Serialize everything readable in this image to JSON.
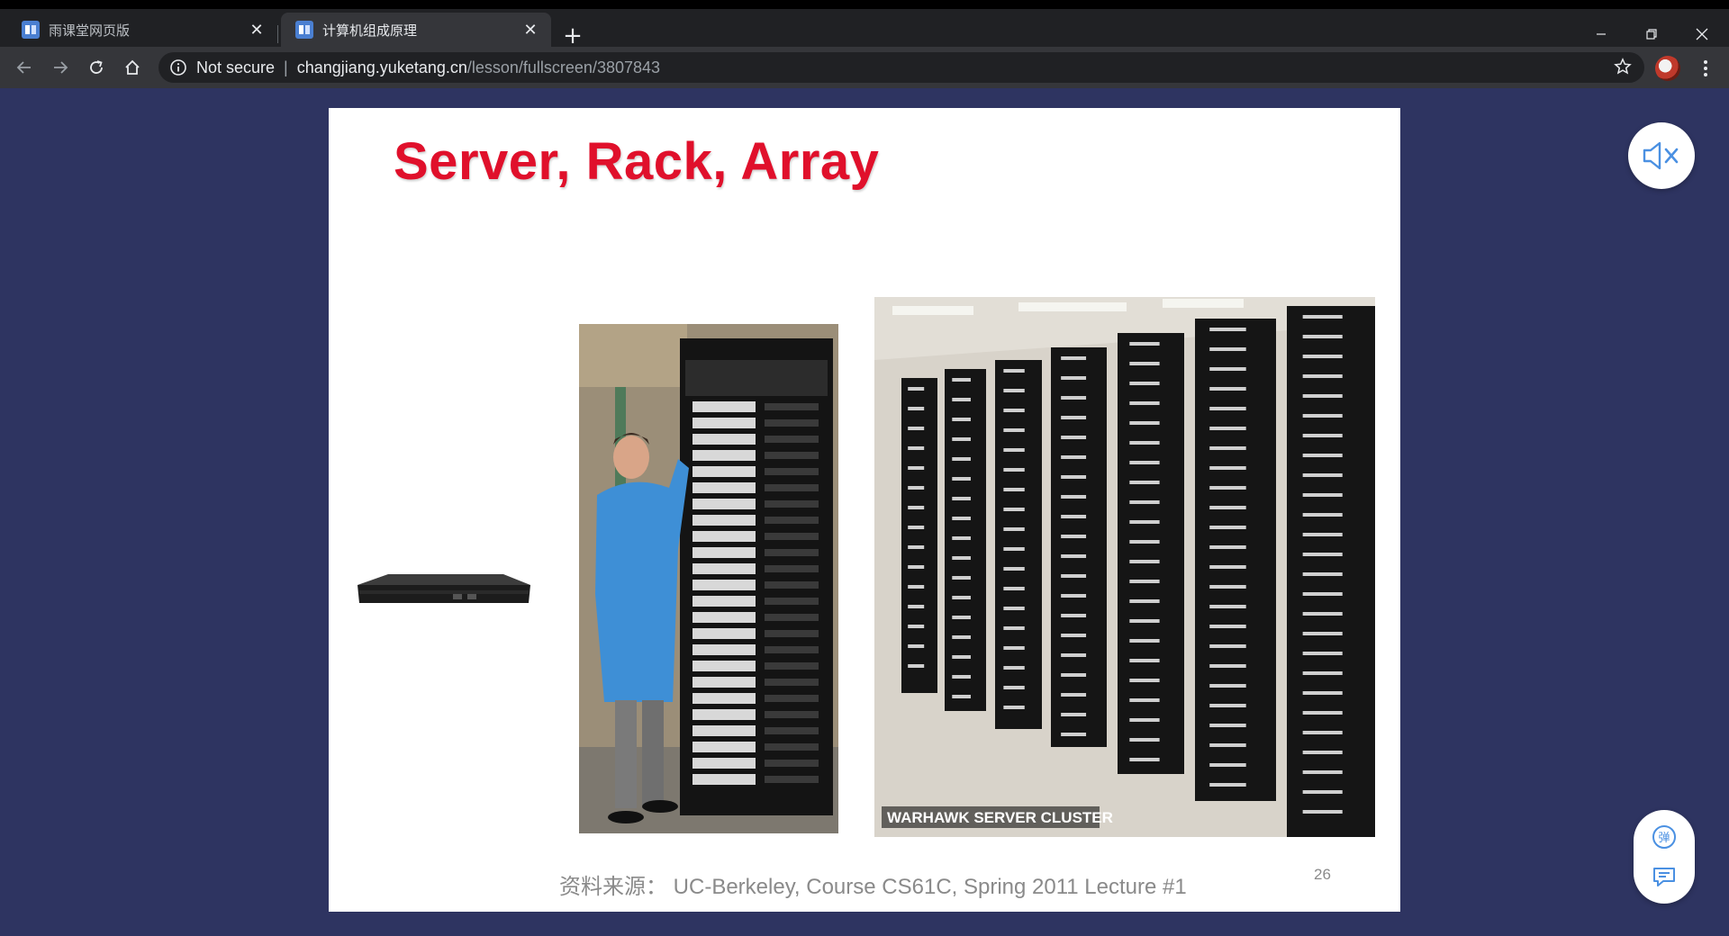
{
  "browser": {
    "tabs": [
      {
        "title": "雨课堂网页版",
        "active": false
      },
      {
        "title": "计算机组成原理",
        "active": true
      }
    ],
    "address": {
      "security_label": "Not secure",
      "host": "changjiang.yuketang.cn",
      "path": "/lesson/fullscreen/3807843"
    }
  },
  "slide": {
    "title": "Server, Rack, Array",
    "photo_caption": "WARHAWK SERVER CLUSTER",
    "source_note": "资料来源： UC-Berkeley,  Course  CS61C,  Spring  2011   Lecture #1",
    "page_number": "26"
  },
  "side_controls": {
    "danmu_label": "弹"
  },
  "colors": {
    "page_background": "#2e3461",
    "title_red": "#e0102b",
    "icon_blue": "#4a90e2",
    "tab_active": "#35363a",
    "tab_strip": "#202124"
  },
  "icons": [
    "yuketang-favicon",
    "close-icon",
    "plus-icon",
    "minimize-icon",
    "restore-icon",
    "back-icon",
    "forward-icon",
    "reload-icon",
    "home-icon",
    "info-icon",
    "star-icon",
    "menu-dots-icon",
    "mute-icon",
    "danmu-icon",
    "comment-icon"
  ]
}
